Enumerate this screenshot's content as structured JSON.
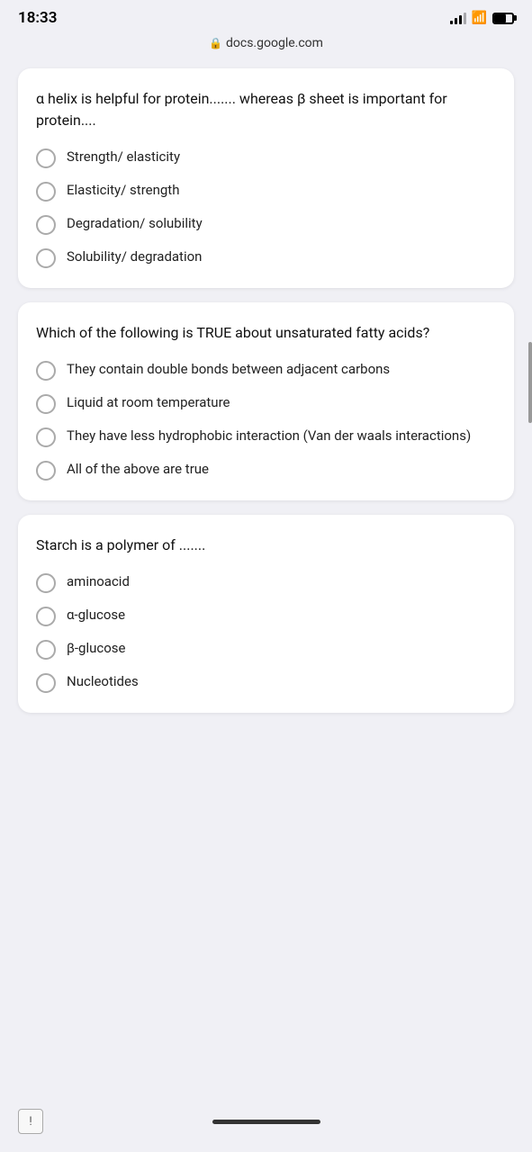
{
  "statusBar": {
    "time": "18:33",
    "url": "docs.google.com"
  },
  "questions": [
    {
      "id": "q1",
      "text": "α helix is helpful for protein....... whereas β sheet is important for protein....",
      "options": [
        {
          "id": "q1a",
          "text": "Strength/ elasticity"
        },
        {
          "id": "q1b",
          "text": "Elasticity/ strength"
        },
        {
          "id": "q1c",
          "text": "Degradation/ solubility"
        },
        {
          "id": "q1d",
          "text": "Solubility/ degradation"
        }
      ]
    },
    {
      "id": "q2",
      "text": "Which of the following is TRUE about unsaturated fatty acids?",
      "options": [
        {
          "id": "q2a",
          "text": "They contain double bonds between adjacent carbons"
        },
        {
          "id": "q2b",
          "text": "Liquid at room temperature"
        },
        {
          "id": "q2c",
          "text": "They have less hydrophobic interaction (Van der waals interactions)"
        },
        {
          "id": "q2d",
          "text": "All of the above are true"
        }
      ]
    },
    {
      "id": "q3",
      "text": "Starch is a polymer of .......",
      "options": [
        {
          "id": "q3a",
          "text": "aminoacid"
        },
        {
          "id": "q3b",
          "text": "α-glucose"
        },
        {
          "id": "q3c",
          "text": "β-glucose"
        },
        {
          "id": "q3d",
          "text": "Nucleotides"
        }
      ]
    }
  ],
  "bottomButton": {
    "label": "!"
  }
}
